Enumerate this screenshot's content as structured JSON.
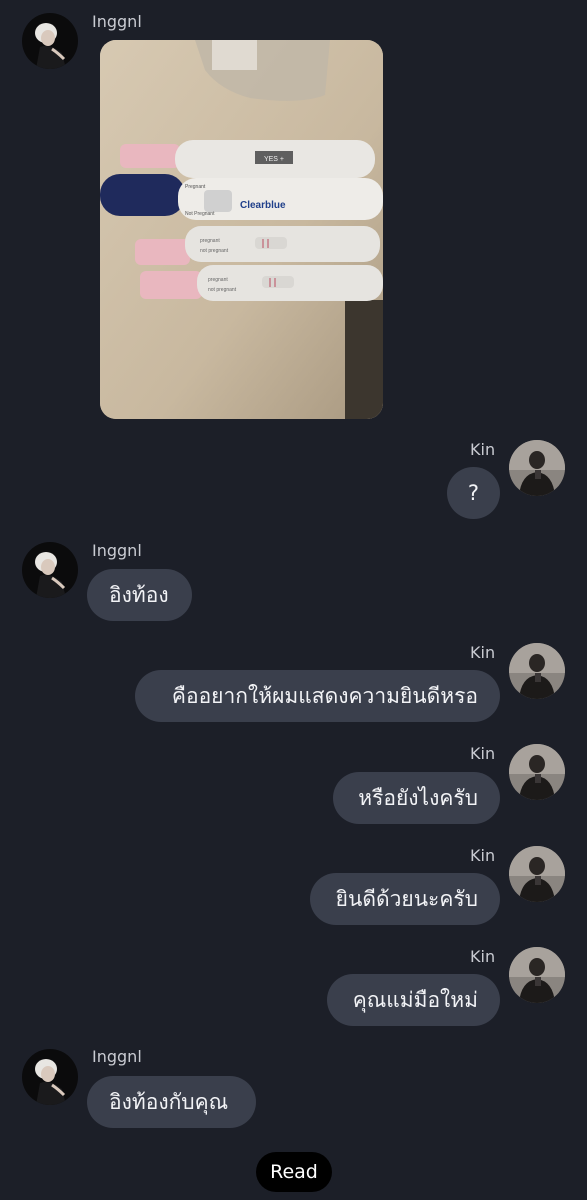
{
  "conversation": {
    "other_user": {
      "name": "Inggnl"
    },
    "self_user": {
      "name": "Kin"
    },
    "messages": [
      {
        "sender": "Inggnl",
        "type": "image",
        "description_icon": "photo-pregnancy-tests",
        "image_text": {
          "test1": "YES +",
          "test2_brand": "Clearblue",
          "test2_pregnant": "Pregnant",
          "test2_not": "Not Pregnant",
          "test3_pregnant": "pregnant",
          "test3_not": "not pregnant",
          "test4_pregnant": "pregnant",
          "test4_not": "not pregnant"
        }
      },
      {
        "sender": "Kin",
        "text": "?"
      },
      {
        "sender": "Inggnl",
        "text": "อิงท้อง"
      },
      {
        "sender": "Kin",
        "text": "คืออยากให้ผมแสดงความยินดีหรอ"
      },
      {
        "sender": "Kin",
        "text": "หรือยังไงครับ"
      },
      {
        "sender": "Kin",
        "text": "ยินดีด้วยนะครับ"
      },
      {
        "sender": "Kin",
        "text": "คุณแม่มือใหม่"
      },
      {
        "sender": "Inggnl",
        "text": "อิงท้องกับคุณ"
      }
    ],
    "read_status": "Read"
  },
  "colors": {
    "background": "#1c1f28",
    "bubble": "#3a3f4c",
    "text": "#f2f3f6",
    "sender_text": "#c9cbd2",
    "read_pill": "#000000"
  }
}
